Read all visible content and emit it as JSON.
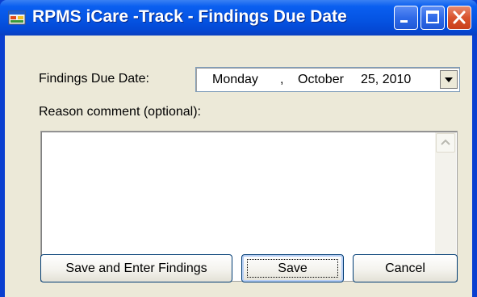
{
  "window": {
    "title": "RPMS iCare -Track - Findings Due Date",
    "controls": [
      "minimize-icon",
      "maximize-icon",
      "close-icon"
    ]
  },
  "form": {
    "due_date_label": "Findings Due Date:",
    "due_date": {
      "weekday": "Monday",
      "separator": ",",
      "month": "October",
      "day_year": "25, 2010"
    },
    "reason_label": "Reason comment (optional):",
    "reason_value": ""
  },
  "buttons": {
    "save_and_enter": "Save and Enter Findings",
    "save": "Save",
    "cancel": "Cancel"
  },
  "colors": {
    "title_bar": "#0554e3",
    "client_bg": "#ece9d8",
    "close_button": "#d9532d"
  }
}
